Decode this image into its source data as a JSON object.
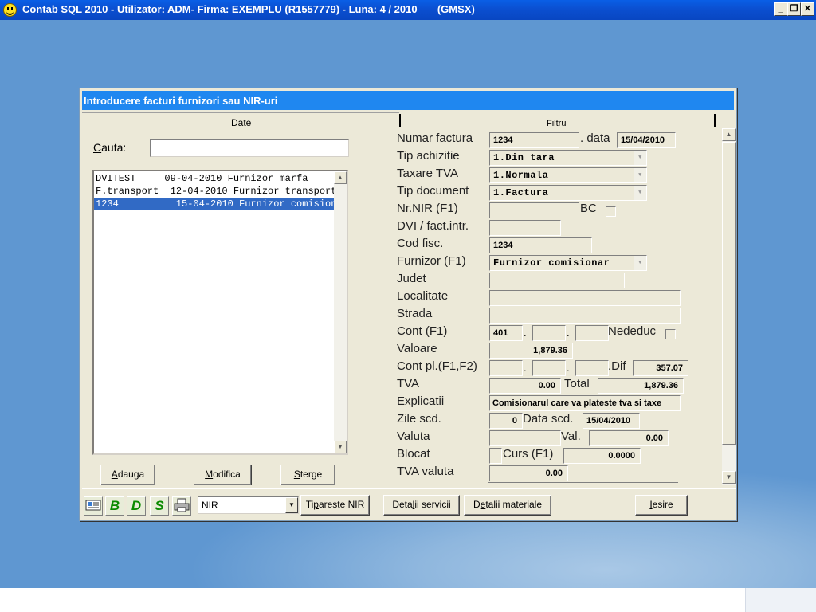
{
  "app": {
    "title": "Contab SQL 2010 - Utilizator: ADM- Firma: EXEMPLU (R1557779) - Luna: 4 / 2010       (GMSX)",
    "window_controls": [
      "_",
      "❐",
      "✕"
    ]
  },
  "dialog": {
    "title": "Introducere facturi furnizori sau NIR-uri",
    "tab_date": "Date",
    "tab_filtru": "Filtru"
  },
  "search": {
    "label_prefix": "C",
    "label_rest": "auta:",
    "value": ""
  },
  "documents": [
    {
      "text": "DVITEST     09-04-2010 Furnizor marfa",
      "selected": false
    },
    {
      "text": "F.transport  12-04-2010 Furnizor transport",
      "selected": false
    },
    {
      "text": "1234          15-04-2010 Furnizor comisionar",
      "selected": true
    }
  ],
  "left_buttons": {
    "add_first": "A",
    "add_rest": "dauga",
    "edit_first": "M",
    "edit_rest": "odifica",
    "delete_first": "S",
    "delete_rest": "terge"
  },
  "form": {
    "labels": {
      "numar_factura": "Numar factura",
      "data": ". data",
      "tip_achizitie": "Tip achizitie",
      "taxare_tva": "Taxare TVA",
      "tip_document": "Tip document",
      "nr_nir": "Nr.NIR (F1)",
      "bc": "BC",
      "dvi": "DVI / fact.intr.",
      "cod_fisc": "Cod fisc.",
      "furnizor": "Furnizor (F1)",
      "judet": "Judet",
      "localitate": "Localitate",
      "strada": "Strada",
      "cont": "Cont (F1)",
      "nededuc": "Nededuc",
      "valoare": "Valoare",
      "cont_pl": "Cont pl.(F1,F2)",
      "dif": ".Dif",
      "tva": "TVA",
      "total": "Total",
      "explicatii": "Explicatii",
      "zile_scd": "Zile scd.",
      "data_scd": "Data scd.",
      "valuta": "Valuta",
      "val": "Val.",
      "blocat": "Blocat",
      "curs": "Curs (F1)",
      "tva_valuta": "TVA valuta"
    },
    "values": {
      "numar_factura": "1234",
      "data": "15/04/2010",
      "tip_achizitie": "1.Din tara",
      "taxare_tva": "1.Normala",
      "tip_document": "1.Factura",
      "nr_nir": "",
      "dvi": "",
      "cod_fisc": "1234",
      "furnizor": "Furnizor comisionar",
      "judet": "",
      "localitate": "",
      "strada": "",
      "cont_1": "401",
      "cont_2": "",
      "cont_3": "",
      "valoare": "1,879.36",
      "cont_pl_1": "",
      "cont_pl_2": "",
      "cont_pl_3": "",
      "dif": "357.07",
      "tva": "0.00",
      "total": "1,879.36",
      "explicatii": "Comisionarul care va plateste tva si taxe",
      "zile_scd": "0",
      "data_scd": "15/04/2010",
      "valuta": "",
      "val": "0.00",
      "blocat": "",
      "curs": "0.0000",
      "tva_valuta": "0.00"
    },
    "dot": "."
  },
  "toolbar": {
    "icon_b": "B",
    "icon_d": "D",
    "icon_s": "S",
    "nir_value": "NIR",
    "print_first": "Ti",
    "print_u": "p",
    "print_rest": "areste NIR",
    "services_first": "Deta",
    "services_u": "l",
    "services_rest": "ii servicii",
    "materials_first": "D",
    "materials_u": "e",
    "materials_rest": "talii materiale",
    "exit_first": "I",
    "exit_rest": "esire"
  },
  "colors": {
    "desktop": "#5f97d1",
    "dialog_title_bar": "#1f87f0",
    "selection": "#316ac5",
    "app_title_bar": "#0b4fd0"
  }
}
